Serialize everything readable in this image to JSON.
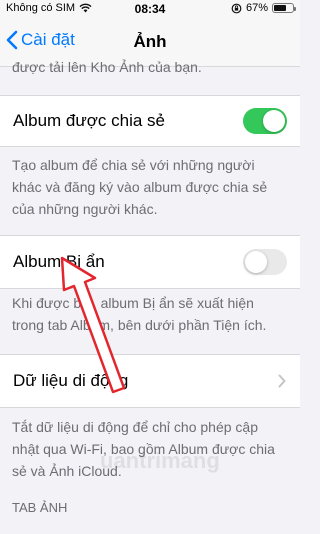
{
  "status_bar": {
    "carrier": "Không có SIM",
    "time": "08:34",
    "battery": "67%",
    "battery_level": 0.67
  },
  "nav": {
    "back_label": "Cài đặt",
    "title": "Ảnh"
  },
  "sections": {
    "top_footer": "được tải lên Kho Ảnh của bạn.",
    "shared_album": {
      "label": "Album được chia sẻ",
      "enabled": true,
      "footer": "Tạo album để chia sẻ với những người khác và đăng ký vào album được chia sẻ của những người khác."
    },
    "hidden_album": {
      "label": "Album Bị ẩn",
      "enabled": false,
      "footer": "Khi được bật, album Bị ẩn sẽ xuất hiện trong tab Album, bên dưới phần Tiện ích."
    },
    "cellular_data": {
      "label": "Dữ liệu di động",
      "footer": "Tắt dữ liệu di động để chỉ cho phép cập nhật qua Wi-Fi, bao gồm Album được chia sẻ và Ảnh iCloud."
    },
    "photos_tab_header": "TAB ẢNH"
  },
  "colors": {
    "accent": "#007aff",
    "toggle_on": "#34c759",
    "annotation_arrow": "#e3262e"
  },
  "watermark": "uantrimang"
}
